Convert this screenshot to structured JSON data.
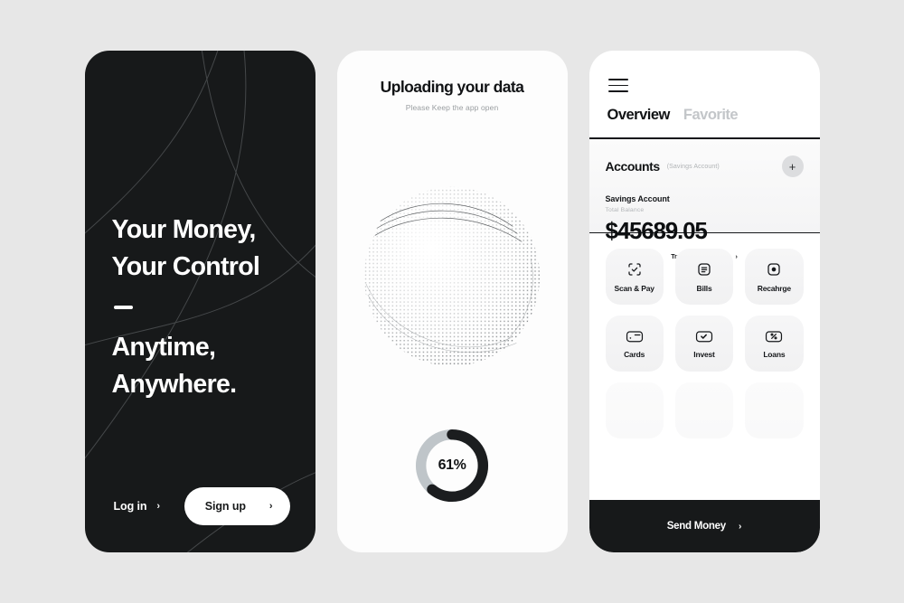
{
  "canvas": {
    "background_color": "#e7e7e7",
    "dark_color": "#17191a",
    "muted_color": "#b4b7ba"
  },
  "onboarding": {
    "headline_lines": [
      "Your Money,",
      "Your Control"
    ],
    "subheadline_lines": [
      "Anytime,",
      "Anywhere."
    ],
    "login_label": "Log in",
    "login_chevron": "›",
    "signup_label": "Sign up",
    "signup_chevron": "›"
  },
  "uploading": {
    "title": "Uploading your data",
    "subtitle": "Please Keep the app open",
    "progress_percent": 61,
    "progress_label": "61%",
    "progress_track_color": "#bfc5c9",
    "progress_fill_color": "#1b1d1f",
    "visual": "particle-sphere"
  },
  "app": {
    "menu_icon": "hamburger-icon",
    "tabs": [
      {
        "label": "Overview",
        "active": true
      },
      {
        "label": "Favorite",
        "active": false
      }
    ],
    "accounts": {
      "title": "Accounts",
      "subtitle": "(Savings Account)",
      "add_button": "+",
      "account_name": "Savings Account",
      "balance_label": "Total Balance",
      "balance": "$45689.05",
      "transaction_link": "Transaction History",
      "transaction_chevron": "›"
    },
    "actions": [
      {
        "label": "Scan & Pay",
        "icon": "scan-pay-icon"
      },
      {
        "label": "Bills",
        "icon": "bills-icon"
      },
      {
        "label": "Recahrge",
        "icon": "recharge-icon"
      },
      {
        "label": "Cards",
        "icon": "cards-icon"
      },
      {
        "label": "Invest",
        "icon": "invest-icon"
      },
      {
        "label": "Loans",
        "icon": "loans-icon"
      }
    ],
    "send_money": {
      "label": "Send Money",
      "chevron": "›"
    }
  }
}
